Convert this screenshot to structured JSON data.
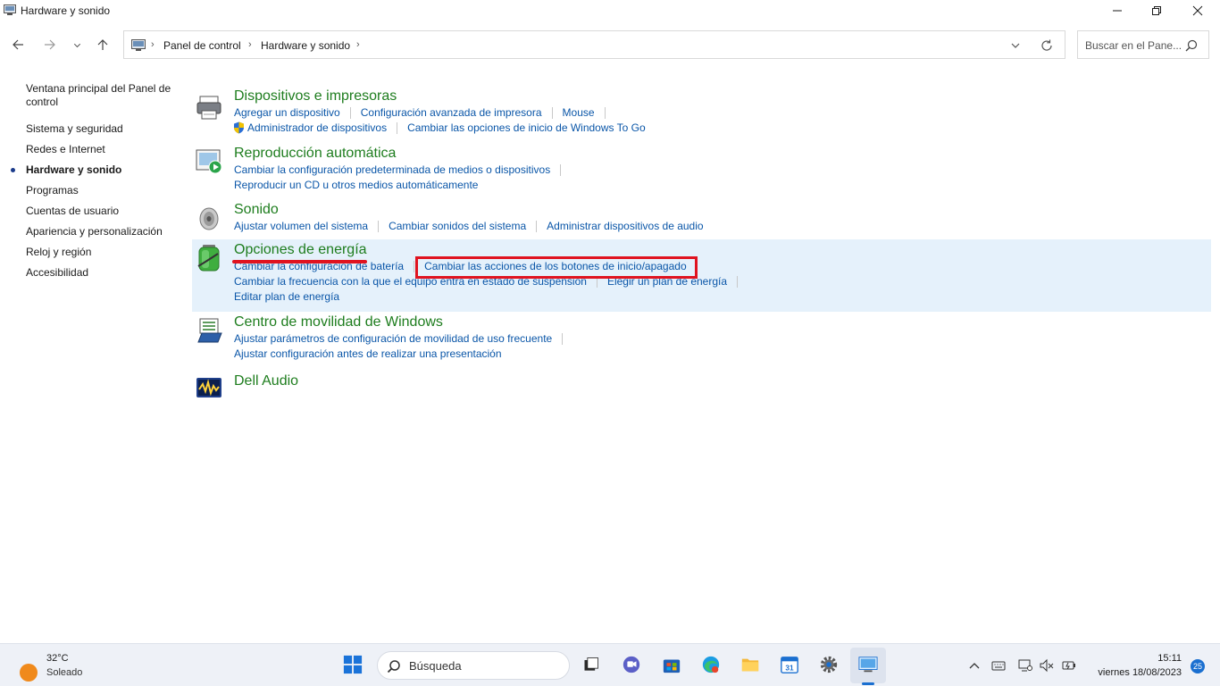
{
  "window": {
    "title": "Hardware y sonido"
  },
  "address": {
    "crumbs": [
      "Panel de control",
      "Hardware y sonido"
    ],
    "search_placeholder": "Buscar en el Pane..."
  },
  "leftnav": {
    "items": [
      {
        "label": "Ventana principal del Panel de control",
        "active": false
      },
      {
        "label": "Sistema y seguridad",
        "active": false
      },
      {
        "label": "Redes e Internet",
        "active": false
      },
      {
        "label": "Hardware y sonido",
        "active": true
      },
      {
        "label": "Programas",
        "active": false
      },
      {
        "label": "Cuentas de usuario",
        "active": false
      },
      {
        "label": "Apariencia y personalización",
        "active": false
      },
      {
        "label": "Reloj y región",
        "active": false
      },
      {
        "label": "Accesibilidad",
        "active": false
      }
    ]
  },
  "categories": [
    {
      "title": "Dispositivos e impresoras",
      "icon": "printer-icon",
      "rows": [
        [
          "Agregar un dispositivo",
          "Configuración avanzada de impresora",
          "Mouse"
        ],
        [
          "Administrador de dispositivos",
          "Cambiar las opciones de inicio de Windows To Go"
        ]
      ]
    },
    {
      "title": "Reproducción automática",
      "icon": "autoplay-icon",
      "rows": [
        [
          "Cambiar la configuración predeterminada de medios o dispositivos"
        ],
        [
          "Reproducir un CD u otros medios automáticamente"
        ]
      ]
    },
    {
      "title": "Sonido",
      "icon": "speaker-icon",
      "rows": [
        [
          "Ajustar volumen del sistema",
          "Cambiar sonidos del sistema",
          "Administrar dispositivos de audio"
        ]
      ]
    },
    {
      "title": "Opciones de energía",
      "icon": "battery-icon",
      "rows": [
        [
          "Cambiar la configuración de batería",
          "Cambiar las acciones de los botones de inicio/apagado"
        ],
        [
          "Cambiar la frecuencia con la que el equipo entra en estado de suspensión",
          "Elegir un plan de energía"
        ],
        [
          "Editar plan de energía"
        ]
      ]
    },
    {
      "title": "Centro de movilidad de Windows",
      "icon": "mobility-center-icon",
      "rows": [
        [
          "Ajustar parámetros de configuración de movilidad de uso frecuente"
        ],
        [
          "Ajustar configuración antes de realizar una presentación"
        ]
      ]
    },
    {
      "title": "Dell Audio",
      "icon": "dell-audio-icon",
      "rows": []
    }
  ],
  "taskbar": {
    "weather_temp": "32°C",
    "weather_cond": "Soleado",
    "search_label": "Búsqueda",
    "time": "15:11",
    "date": "viernes 18/08/2023",
    "notification_count": "25",
    "calendar_day": "31"
  },
  "colors": {
    "category_title": "#1e7d1e",
    "link": "#0a56a8",
    "highlight_bg": "#e5f1fb",
    "annotation": "#e0131f"
  }
}
